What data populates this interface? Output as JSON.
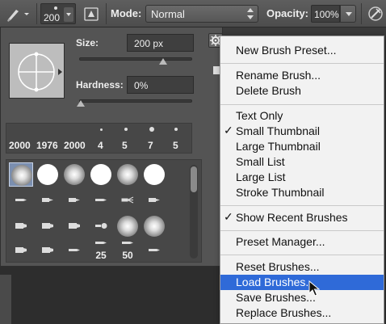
{
  "options_bar": {
    "brush_size": "200",
    "mode_label": "Mode:",
    "mode_value": "Normal",
    "opacity_label": "Opacity:",
    "opacity_value": "100%"
  },
  "brush_panel": {
    "size_label": "Size:",
    "size_value": "200 px",
    "size_slider_fraction": 0.74,
    "hardness_label": "Hardness:",
    "hardness_value": "0%",
    "hardness_slider_fraction": 0.0,
    "recent_brushes": [
      {
        "label": "2000"
      },
      {
        "label": "1976"
      },
      {
        "label": "2000"
      },
      {
        "label": "4"
      },
      {
        "label": "5"
      },
      {
        "label": "7"
      },
      {
        "label": "5"
      }
    ],
    "grid_numbers": [
      "25",
      "50"
    ]
  },
  "menu": {
    "groups": [
      [
        {
          "label": "New Brush Preset...",
          "checked": false
        }
      ],
      [
        {
          "label": "Rename Brush...",
          "checked": false
        },
        {
          "label": "Delete Brush",
          "checked": false
        }
      ],
      [
        {
          "label": "Text Only",
          "checked": false
        },
        {
          "label": "Small Thumbnail",
          "checked": true
        },
        {
          "label": "Large Thumbnail",
          "checked": false
        },
        {
          "label": "Small List",
          "checked": false
        },
        {
          "label": "Large List",
          "checked": false
        },
        {
          "label": "Stroke Thumbnail",
          "checked": false
        }
      ],
      [
        {
          "label": "Show Recent Brushes",
          "checked": true
        }
      ],
      [
        {
          "label": "Preset Manager...",
          "checked": false
        }
      ],
      [
        {
          "label": "Reset Brushes...",
          "checked": false
        },
        {
          "label": "Load Brushes...",
          "checked": false,
          "highlighted": true
        },
        {
          "label": "Save Brushes...",
          "checked": false
        },
        {
          "label": "Replace Brushes...",
          "checked": false
        }
      ]
    ],
    "check_glyph": "✓",
    "highlight_color": "#2f6ad8"
  },
  "icons": {
    "brush_tool": "brush-tool-icon",
    "toggle_brush_panel": "brush-panel-toggle-icon",
    "airbrush": "airbrush-icon",
    "gear": "gear-icon"
  }
}
